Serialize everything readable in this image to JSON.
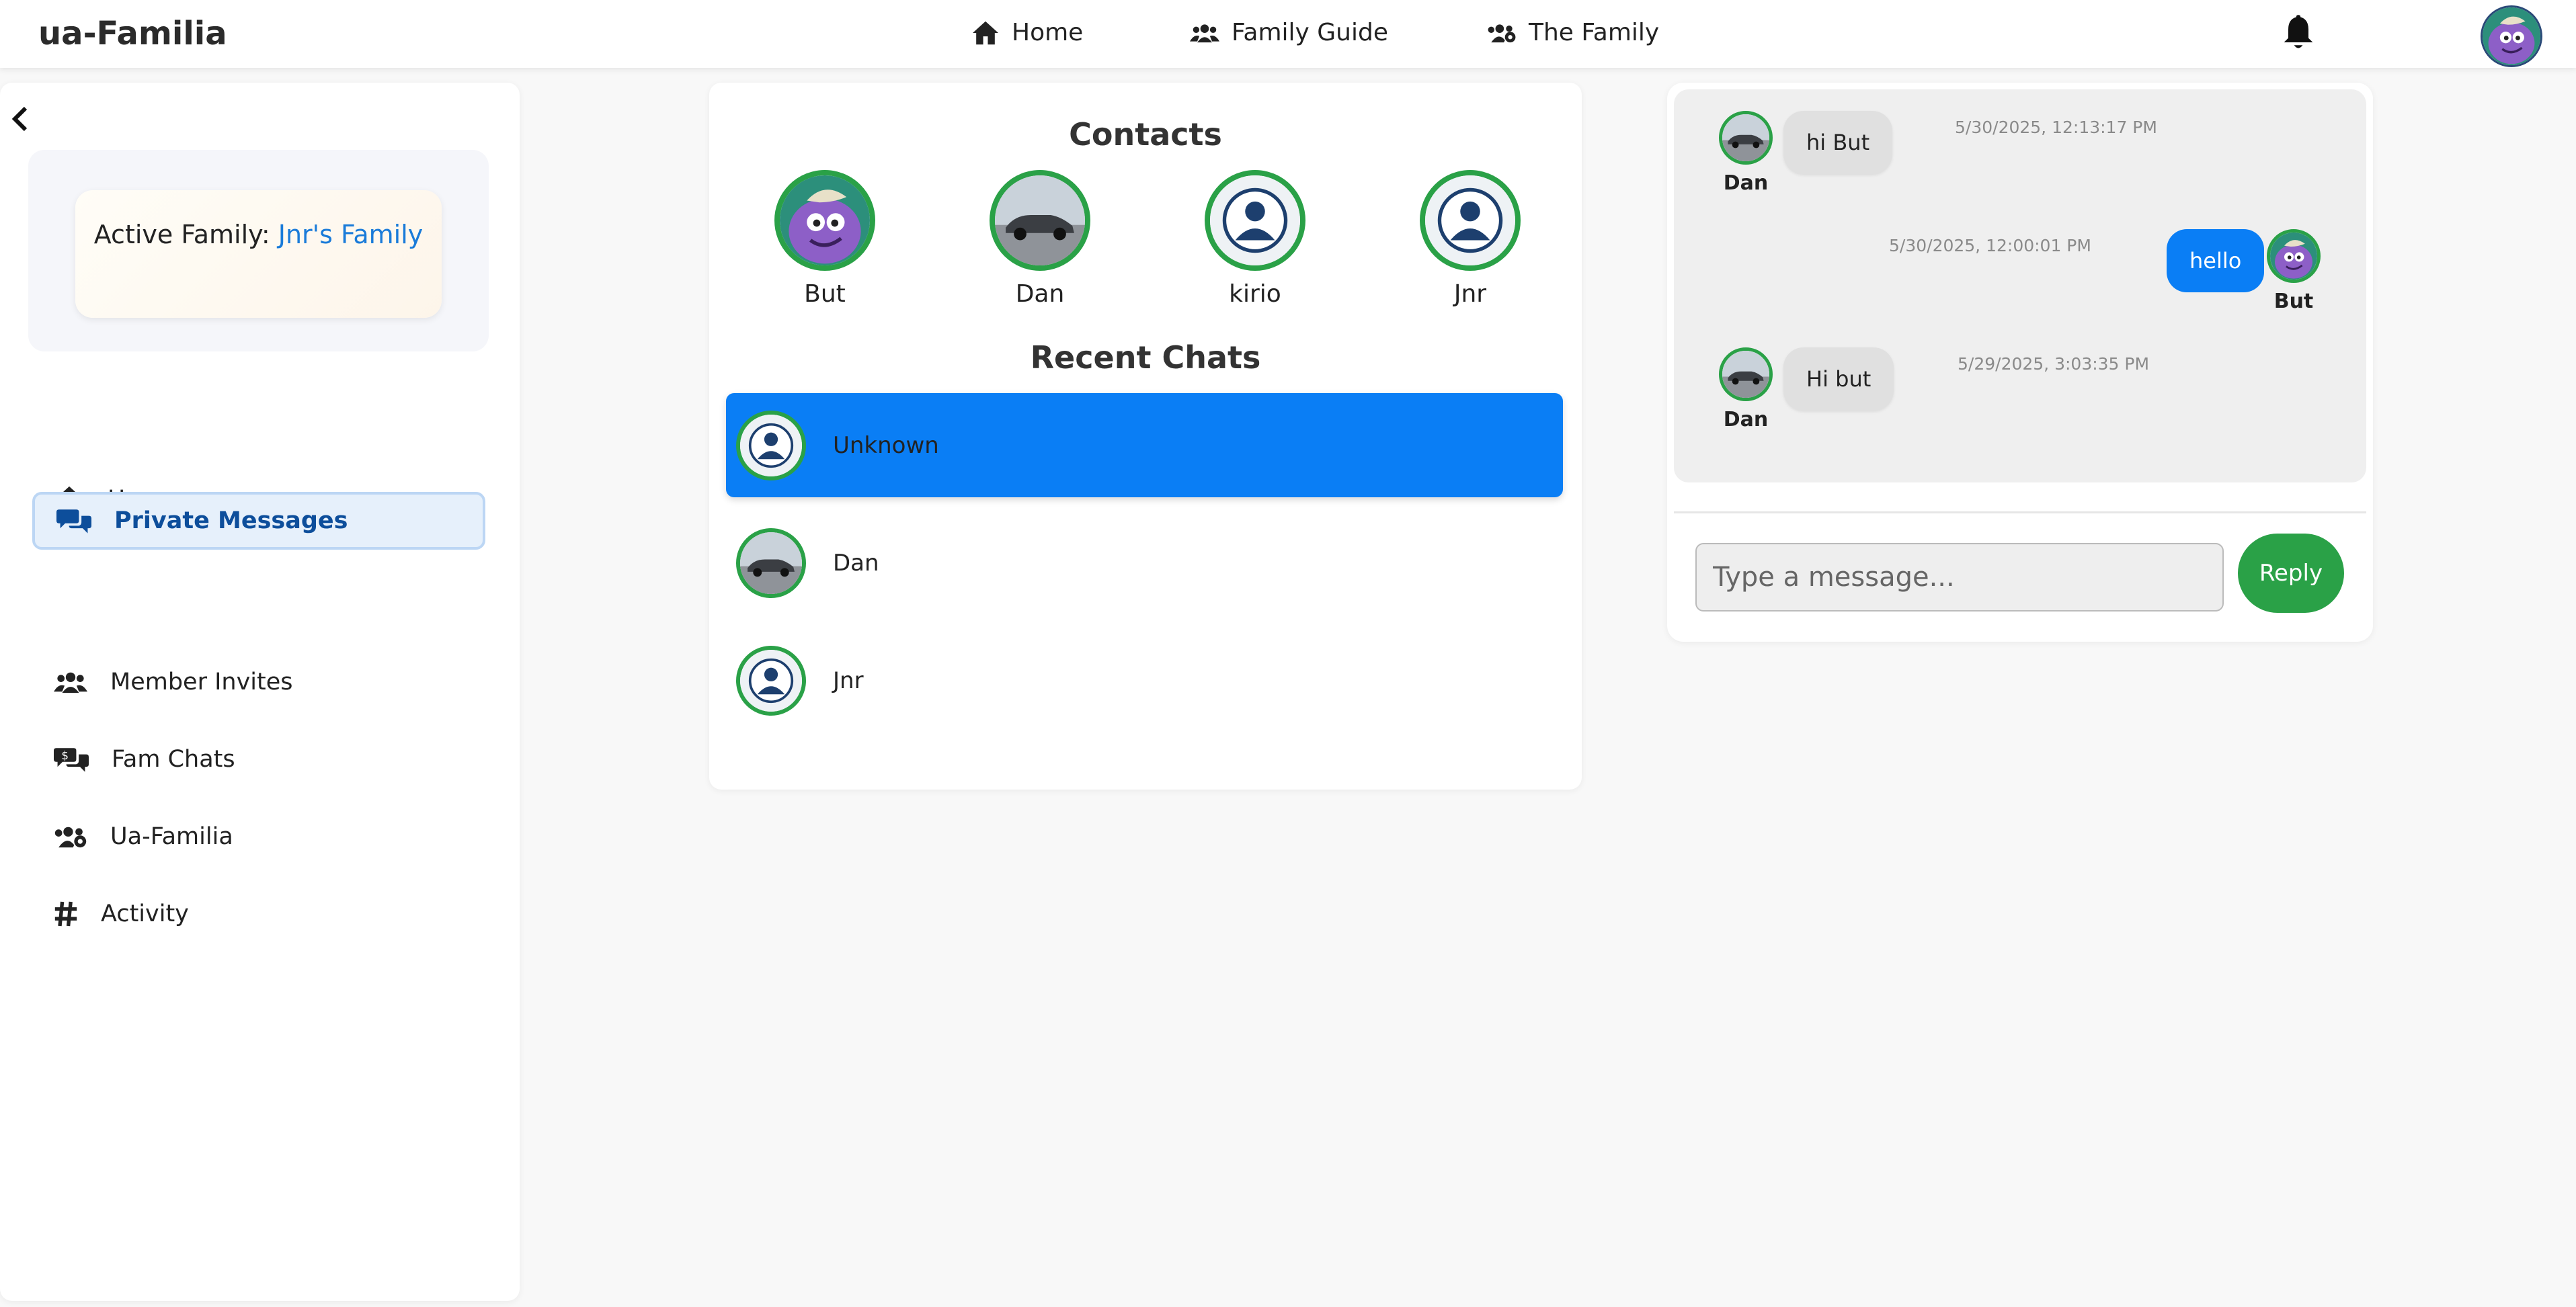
{
  "app": {
    "brand": "ua-Familia"
  },
  "topnav": {
    "items": [
      {
        "label": "Home",
        "icon": "home-icon"
      },
      {
        "label": "Family Guide",
        "icon": "users-icon"
      },
      {
        "label": "The Family",
        "icon": "users-gear-icon"
      }
    ]
  },
  "sidebar": {
    "active_family_prefix": "Active Family:",
    "active_family_name": "Jnr's Family",
    "items": [
      {
        "label": "Home",
        "icon": "home-icon"
      },
      {
        "label": "Private Messages",
        "icon": "comments-icon",
        "active": true
      },
      {
        "label": "Member Invites",
        "icon": "users-icon"
      },
      {
        "label": "Fam Chats",
        "icon": "comments-dollar-icon"
      },
      {
        "label": "Ua-Familia",
        "icon": "users-gear-icon"
      },
      {
        "label": "Activity",
        "icon": "hashtag-icon"
      }
    ]
  },
  "contacts": {
    "title": "Contacts",
    "list": [
      {
        "name": "But",
        "avatar": "monster"
      },
      {
        "name": "Dan",
        "avatar": "car"
      },
      {
        "name": "kirio",
        "avatar": "default"
      },
      {
        "name": "Jnr",
        "avatar": "default"
      }
    ]
  },
  "recent_chats": {
    "title": "Recent Chats",
    "list": [
      {
        "name": "Unknown",
        "avatar": "default",
        "selected": true
      },
      {
        "name": "Dan",
        "avatar": "car"
      },
      {
        "name": "Jnr",
        "avatar": "default"
      }
    ]
  },
  "chat": {
    "messages": [
      {
        "sender": "Dan",
        "text": "hi But",
        "time": "5/30/2025, 12:13:17 PM",
        "direction": "in"
      },
      {
        "sender": "But",
        "text": "hello",
        "time": "5/30/2025, 12:00:01 PM",
        "direction": "out"
      },
      {
        "sender": "Dan",
        "text": "Hi but",
        "time": "5/29/2025, 3:03:35 PM",
        "direction": "in"
      }
    ],
    "input_placeholder": "Type a message...",
    "reply_label": "Reply"
  },
  "colors": {
    "accent_blue": "#0a7ef5",
    "green": "#2aa147",
    "active_family": "#1a7bd9"
  }
}
